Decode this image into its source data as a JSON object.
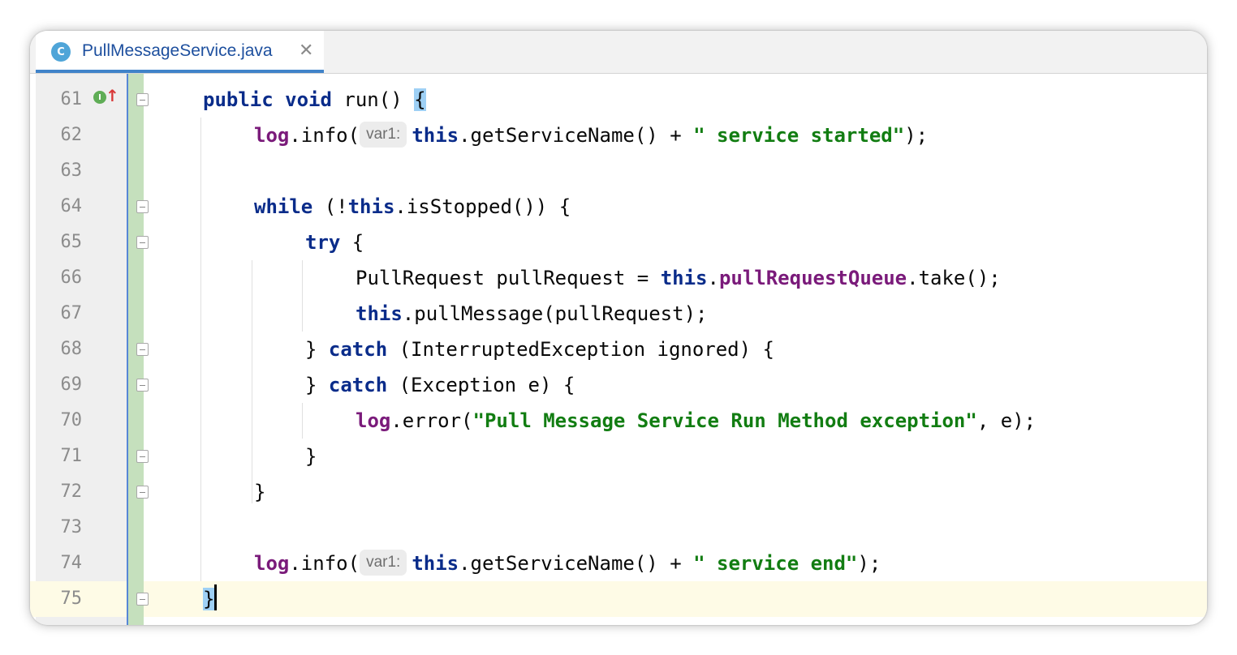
{
  "tab": {
    "icon_letter": "C",
    "file_name": "PullMessageService.java",
    "close_glyph": "✕"
  },
  "gutter": {
    "implements_badge": "I",
    "overrides_arrow": "↑",
    "line_numbers": [
      "61",
      "62",
      "63",
      "64",
      "65",
      "66",
      "67",
      "68",
      "69",
      "70",
      "71",
      "72",
      "73",
      "74",
      "75"
    ]
  },
  "colors": {
    "keyword": "#0a2c8a",
    "string": "#127d12",
    "field": "#7a1a7a",
    "accent": "#4083c9",
    "change_marker": "#c5e0bd"
  },
  "code": {
    "l61": {
      "kw1": "public",
      "kw2": "void",
      "rest": " run() ",
      "brace": "{"
    },
    "l62": {
      "obj": "log",
      "call": ".info(",
      "hint": "var1:",
      "kw": "this",
      "mid": ".getServiceName() + ",
      "str": "\" service started\"",
      "end": ");"
    },
    "l64": {
      "kw1": "while",
      "mid": " (!",
      "kw2": "this",
      "end": ".isStopped()) {"
    },
    "l65": {
      "kw": "try",
      "end": " {"
    },
    "l66": {
      "start": "PullRequest pullRequest = ",
      "kw": "this",
      "dot": ".",
      "field": "pullRequestQueue",
      "end": ".take();"
    },
    "l67": {
      "kw": "this",
      "end": ".pullMessage(pullRequest);"
    },
    "l68": {
      "start": "} ",
      "kw": "catch",
      "end": " (InterruptedException ignored) {"
    },
    "l69": {
      "start": "} ",
      "kw": "catch",
      "end": " (Exception e) {"
    },
    "l70": {
      "obj": "log",
      "call": ".error(",
      "str": "\"Pull Message Service Run Method exception\"",
      "end": ", e);"
    },
    "l71": {
      "text": "}"
    },
    "l72": {
      "text": "}"
    },
    "l74": {
      "obj": "log",
      "call": ".info(",
      "hint": "var1:",
      "kw": "this",
      "mid": ".getServiceName() + ",
      "str": "\" service end\"",
      "end": ");"
    },
    "l75": {
      "brace": "}"
    }
  }
}
